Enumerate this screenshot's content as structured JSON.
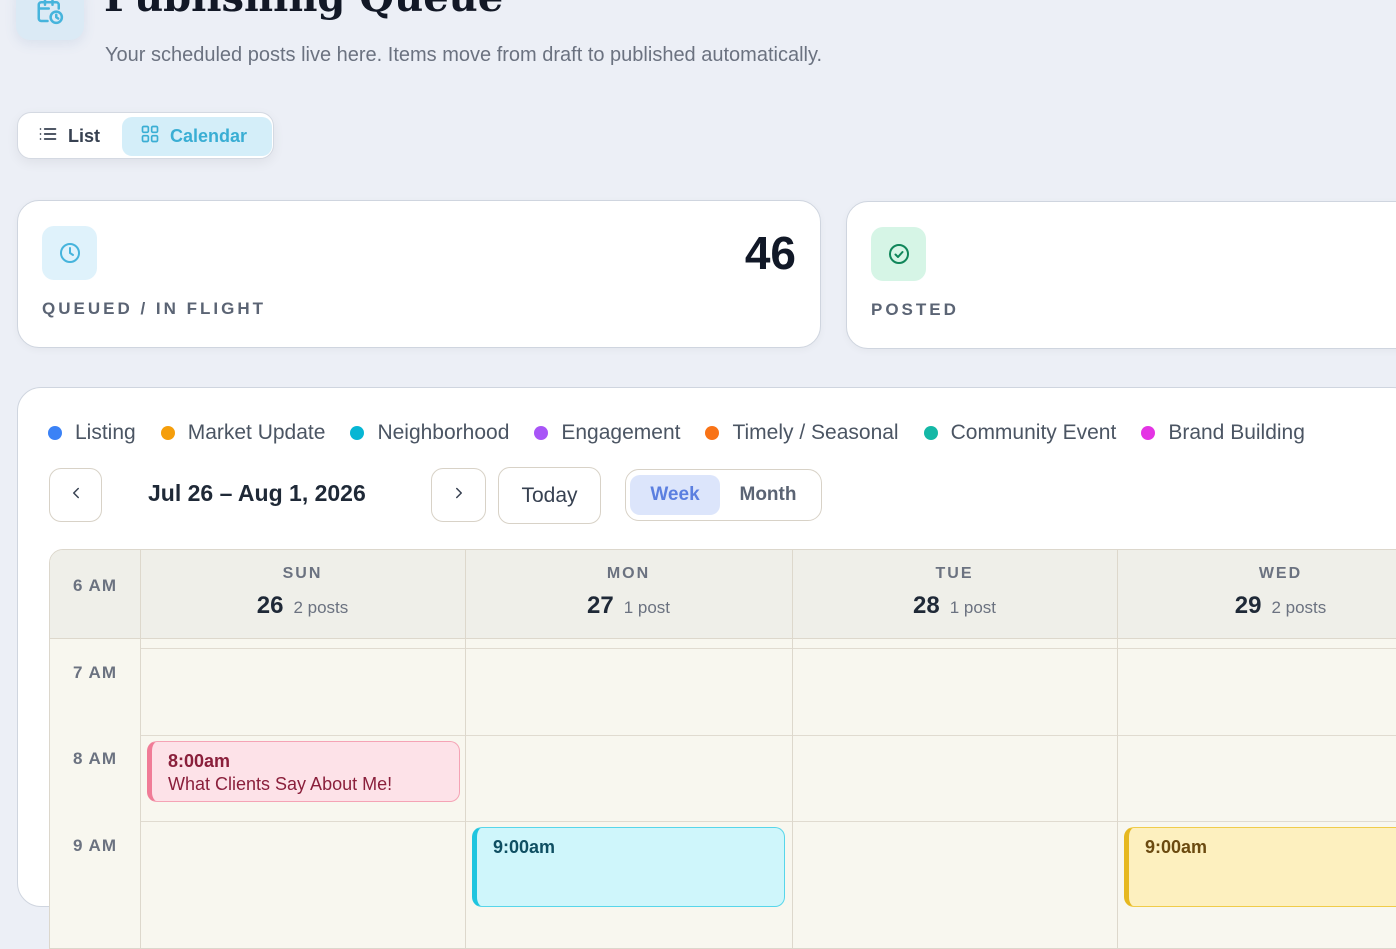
{
  "header": {
    "icon": "calendar-clock-icon",
    "title": "Publishing Queue",
    "subtitle": "Your scheduled posts live here. Items move from draft to published automatically."
  },
  "view_toggle": {
    "list_label": "List",
    "calendar_label": "Calendar",
    "active": "Calendar"
  },
  "stats": [
    {
      "icon": "clock-icon",
      "label": "QUEUED / IN FLIGHT",
      "value": "46",
      "icon_bg": "#dff2fb",
      "icon_color": "#46b4dc"
    },
    {
      "icon": "check-circle-icon",
      "label": "POSTED",
      "value": "",
      "icon_bg": "#d6f5e6",
      "icon_color": "#10865a"
    }
  ],
  "legend": [
    {
      "label": "Listing",
      "color": "#3b82f6"
    },
    {
      "label": "Market Update",
      "color": "#f59e0b"
    },
    {
      "label": "Neighborhood",
      "color": "#06b6d4"
    },
    {
      "label": "Engagement",
      "color": "#a855f7"
    },
    {
      "label": "Timely / Seasonal",
      "color": "#f97316"
    },
    {
      "label": "Community Event",
      "color": "#14b8a6"
    },
    {
      "label": "Brand Building",
      "color": "#e434e4"
    }
  ],
  "calendar_nav": {
    "range": "Jul 26 – Aug 1, 2026",
    "today_label": "Today",
    "week_label": "Week",
    "month_label": "Month",
    "active_mode": "Week"
  },
  "calendar": {
    "days": [
      {
        "name": "SUN",
        "date": "26",
        "count": "2 posts"
      },
      {
        "name": "MON",
        "date": "27",
        "count": "1 post"
      },
      {
        "name": "TUE",
        "date": "28",
        "count": "1 post"
      },
      {
        "name": "WED",
        "date": "29",
        "count": "2 posts"
      }
    ],
    "hours": [
      "6 AM",
      "7 AM",
      "8 AM",
      "9 AM"
    ],
    "events": [
      {
        "day": "SUN",
        "time": "8:00am",
        "title": "What Clients Say About Me!"
      },
      {
        "day": "MON",
        "time": "9:00am",
        "title": ""
      },
      {
        "day": "WED",
        "time": "9:00am",
        "title": ""
      }
    ]
  }
}
